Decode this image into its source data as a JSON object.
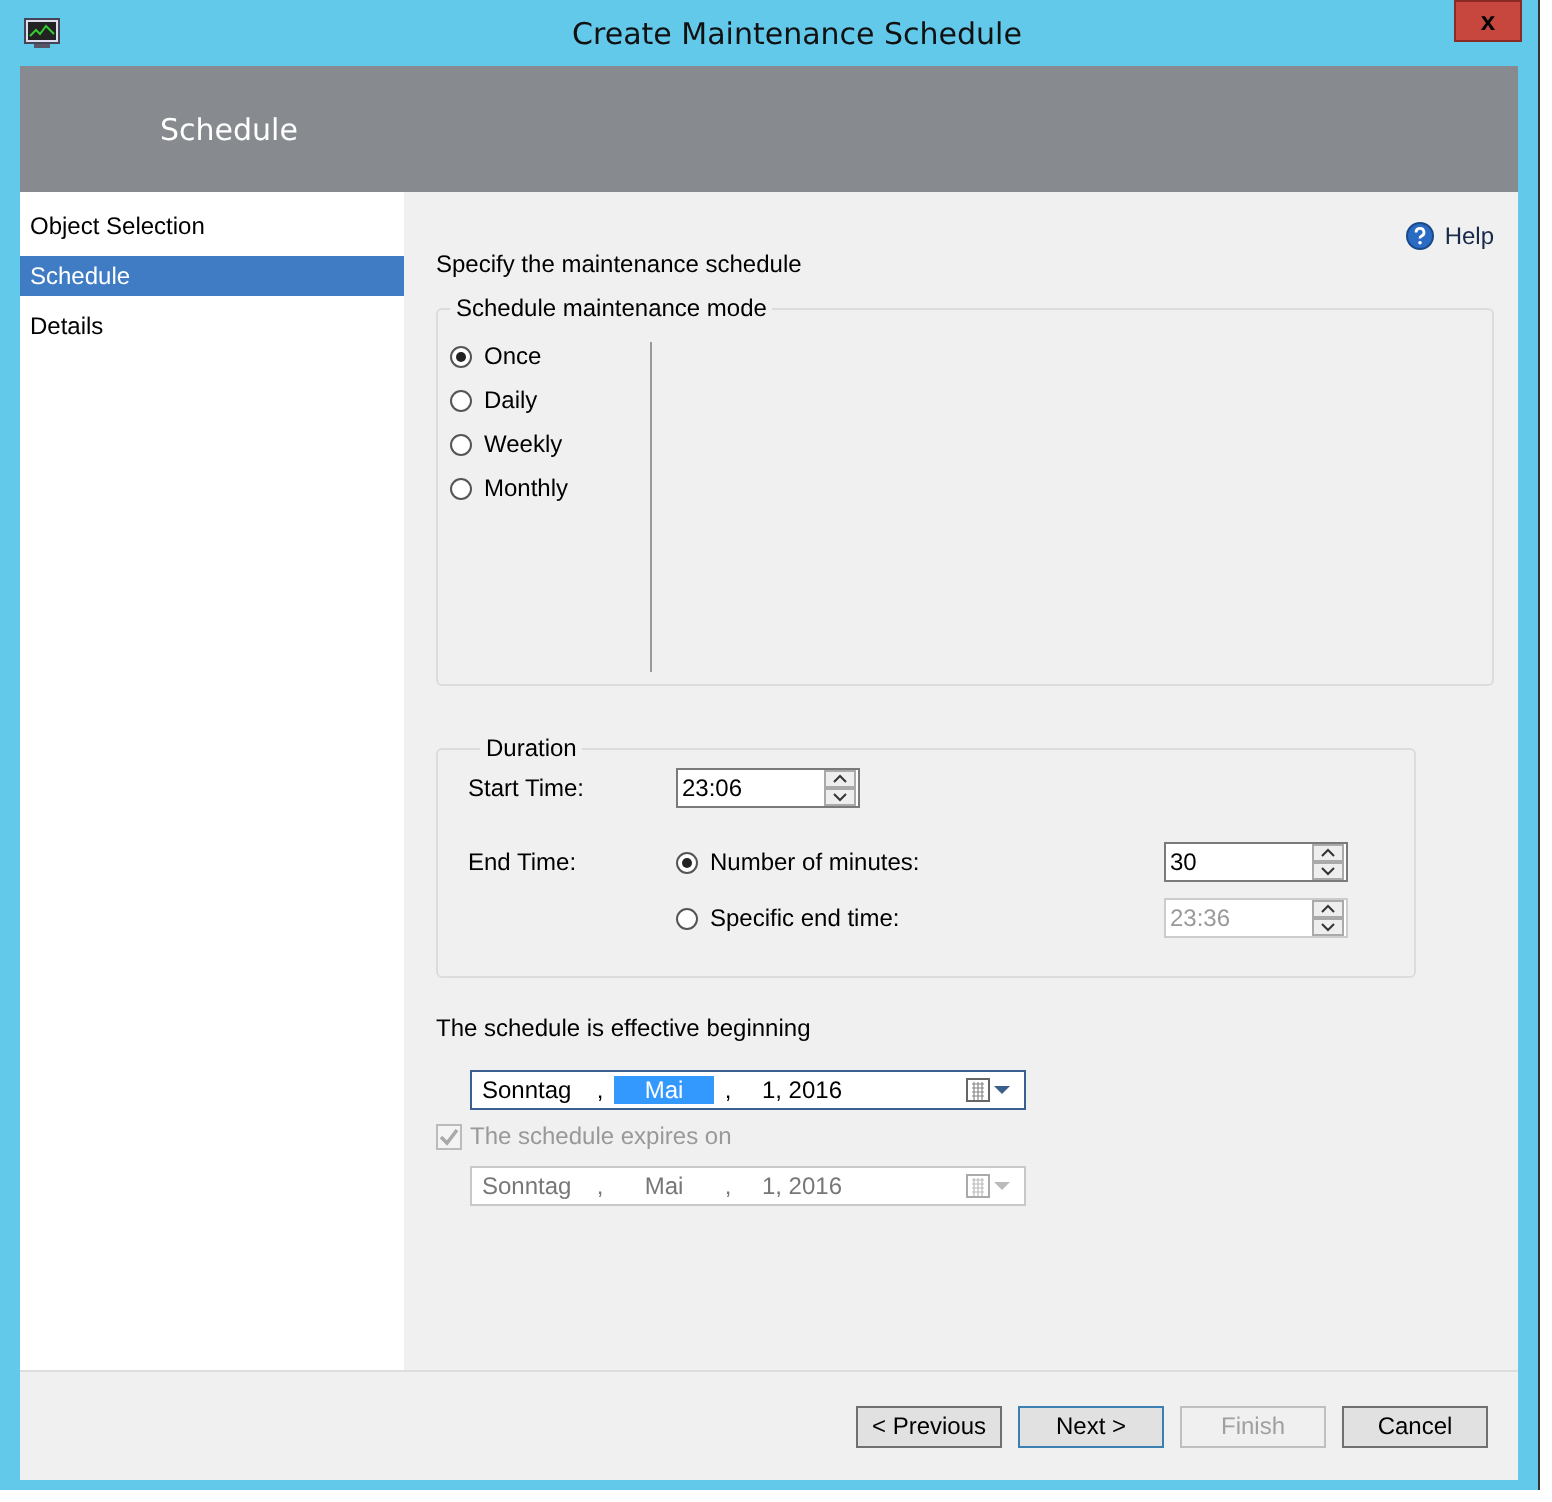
{
  "window": {
    "title": "Create Maintenance Schedule",
    "close": "x"
  },
  "header": {
    "title": "Schedule"
  },
  "sidebar": {
    "items": [
      {
        "label": "Object Selection",
        "selected": false
      },
      {
        "label": "Schedule",
        "selected": true
      },
      {
        "label": "Details",
        "selected": false
      }
    ]
  },
  "help": {
    "label": "Help"
  },
  "intro": "Specify the maintenance schedule",
  "mode": {
    "legend": "Schedule maintenance mode",
    "options": [
      {
        "label": "Once",
        "selected": true
      },
      {
        "label": "Daily",
        "selected": false
      },
      {
        "label": "Weekly",
        "selected": false
      },
      {
        "label": "Monthly",
        "selected": false
      }
    ]
  },
  "duration": {
    "legend": "Duration",
    "start_label": "Start Time:",
    "start_value": "23:06",
    "end_label": "End Time:",
    "end_options": [
      {
        "label": "Number of minutes:",
        "selected": true,
        "value": "30"
      },
      {
        "label": "Specific end time:",
        "selected": false,
        "value": "23:36"
      }
    ]
  },
  "effective": {
    "label": "The schedule is effective beginning",
    "disabled": false,
    "segments": [
      {
        "text": "Sonntag",
        "selected": false
      },
      {
        "text": ",",
        "selected": false
      },
      {
        "text": "Mai",
        "selected": true
      },
      {
        "text": ",",
        "selected": false
      },
      {
        "text": "1, 2016",
        "selected": false
      }
    ]
  },
  "expires": {
    "label": "The schedule expires on",
    "checked": true,
    "disabled": true,
    "segments": [
      {
        "text": "Sonntag",
        "selected": false
      },
      {
        "text": ",",
        "selected": false
      },
      {
        "text": "Mai",
        "selected": false
      },
      {
        "text": ",",
        "selected": false
      },
      {
        "text": "1, 2016",
        "selected": false
      }
    ]
  },
  "buttons": [
    {
      "label": "< Previous",
      "disabled": false,
      "focused": false
    },
    {
      "label": "Next >",
      "disabled": false,
      "focused": true
    },
    {
      "label": "Finish",
      "disabled": true,
      "focused": false
    },
    {
      "label": "Cancel",
      "disabled": false,
      "focused": false
    }
  ]
}
